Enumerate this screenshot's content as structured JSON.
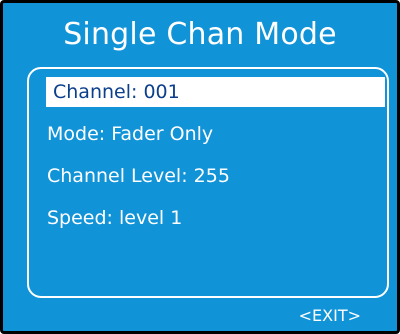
{
  "screen": {
    "title": "Single Chan Mode",
    "menu_items": [
      {
        "label": "Channel: 001",
        "selected": true
      },
      {
        "label": "Mode: Fader Only",
        "selected": false
      },
      {
        "label": "Channel Level: 255",
        "selected": false
      },
      {
        "label": "Speed: level 1",
        "selected": false
      }
    ],
    "exit_label": "<EXIT>"
  },
  "colors": {
    "background": "#1193d8",
    "text": "#ffffff",
    "selected_text": "#0b3f8c",
    "selected_background": "#ffffff",
    "frame": "#000000"
  }
}
